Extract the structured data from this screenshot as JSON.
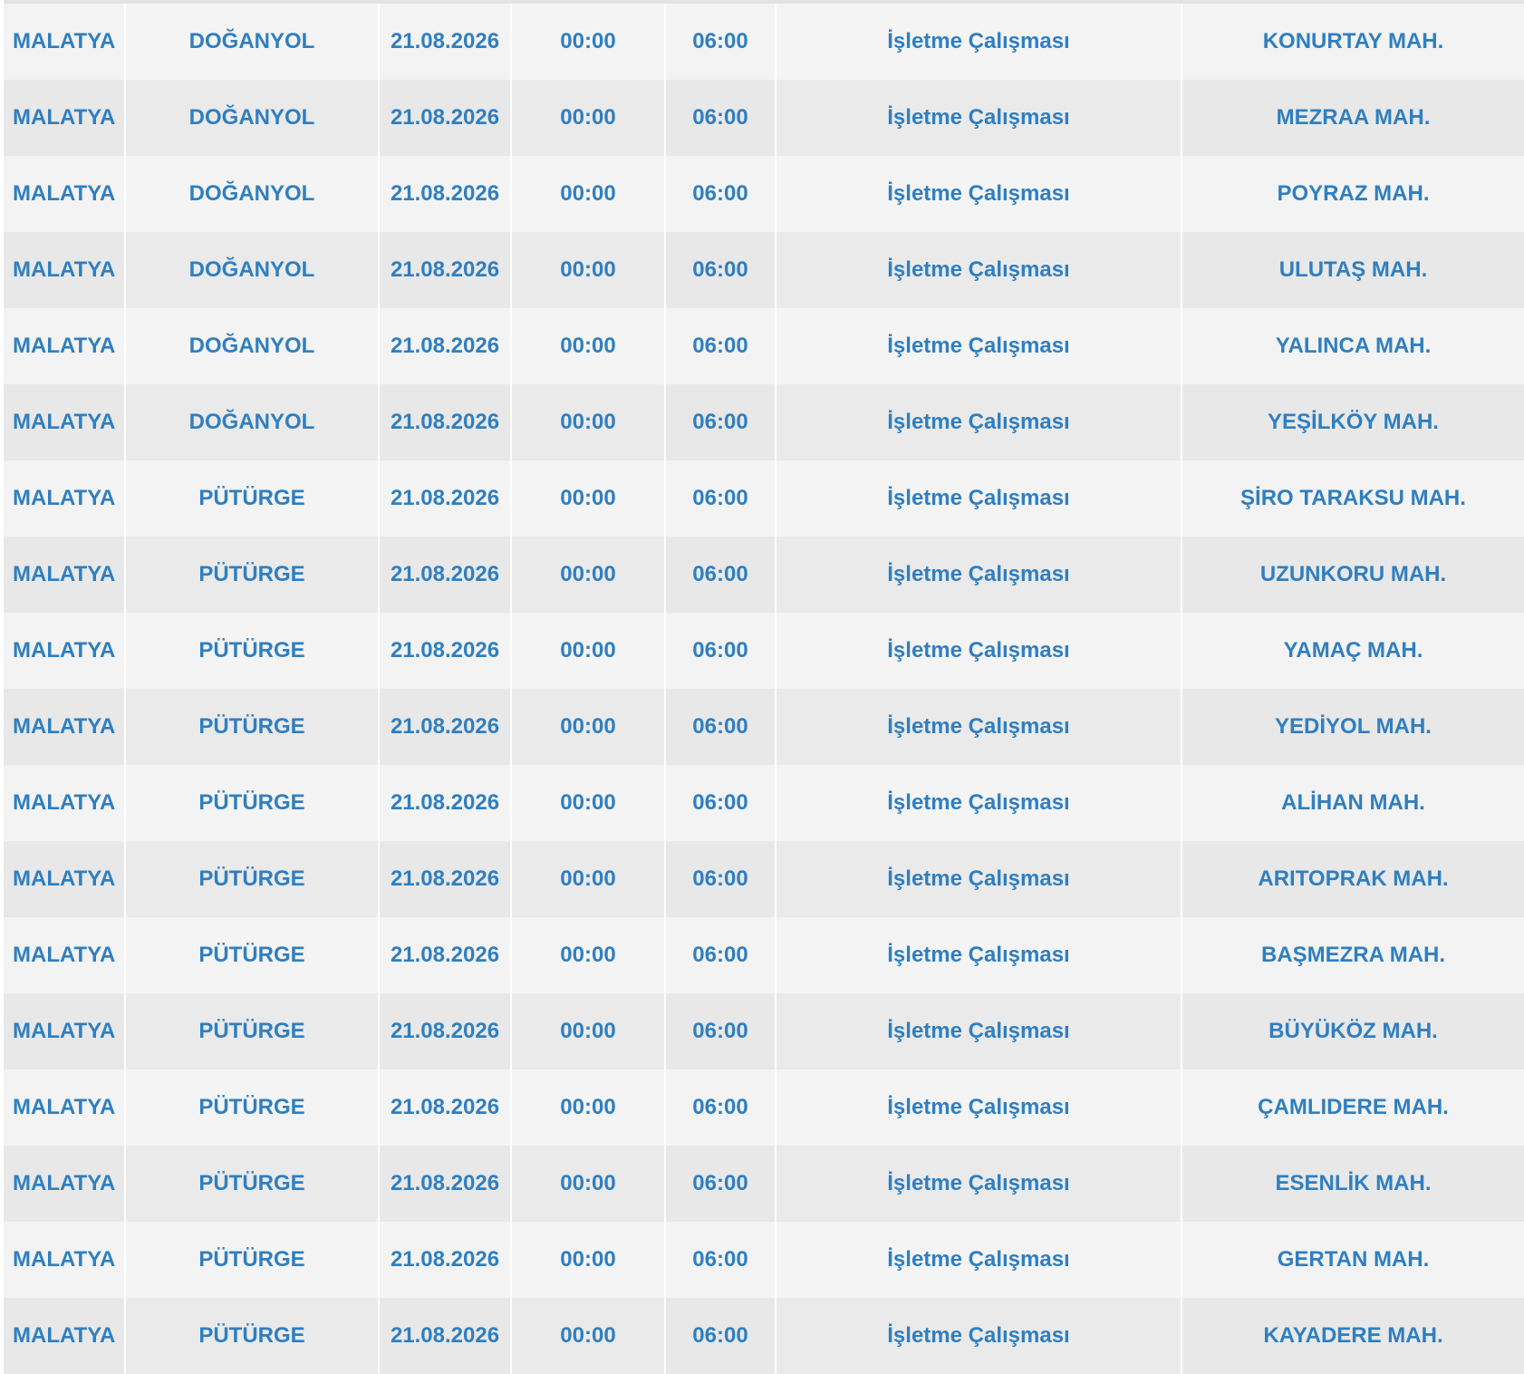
{
  "table": {
    "colors": {
      "text": "#2f7fc1",
      "row_light": "#f3f3f3",
      "row_dark": "#e8e8e8"
    },
    "rows": [
      {
        "il": "MALATYA",
        "ilce": "DOĞANYOL",
        "tarih": "21.08.2026",
        "baslangic": "00:00",
        "bitis": "06:00",
        "aciklama": "İşletme Çalışması",
        "mahalle": "KONURTAY MAH."
      },
      {
        "il": "MALATYA",
        "ilce": "DOĞANYOL",
        "tarih": "21.08.2026",
        "baslangic": "00:00",
        "bitis": "06:00",
        "aciklama": "İşletme Çalışması",
        "mahalle": "MEZRAA MAH."
      },
      {
        "il": "MALATYA",
        "ilce": "DOĞANYOL",
        "tarih": "21.08.2026",
        "baslangic": "00:00",
        "bitis": "06:00",
        "aciklama": "İşletme Çalışması",
        "mahalle": "POYRAZ MAH."
      },
      {
        "il": "MALATYA",
        "ilce": "DOĞANYOL",
        "tarih": "21.08.2026",
        "baslangic": "00:00",
        "bitis": "06:00",
        "aciklama": "İşletme Çalışması",
        "mahalle": "ULUTAŞ MAH."
      },
      {
        "il": "MALATYA",
        "ilce": "DOĞANYOL",
        "tarih": "21.08.2026",
        "baslangic": "00:00",
        "bitis": "06:00",
        "aciklama": "İşletme Çalışması",
        "mahalle": "YALINCA MAH."
      },
      {
        "il": "MALATYA",
        "ilce": "DOĞANYOL",
        "tarih": "21.08.2026",
        "baslangic": "00:00",
        "bitis": "06:00",
        "aciklama": "İşletme Çalışması",
        "mahalle": "YEŞİLKÖY MAH."
      },
      {
        "il": "MALATYA",
        "ilce": "PÜTÜRGE",
        "tarih": "21.08.2026",
        "baslangic": "00:00",
        "bitis": "06:00",
        "aciklama": "İşletme Çalışması",
        "mahalle": "ŞİRO TARAKSU MAH."
      },
      {
        "il": "MALATYA",
        "ilce": "PÜTÜRGE",
        "tarih": "21.08.2026",
        "baslangic": "00:00",
        "bitis": "06:00",
        "aciklama": "İşletme Çalışması",
        "mahalle": "UZUNKORU MAH."
      },
      {
        "il": "MALATYA",
        "ilce": "PÜTÜRGE",
        "tarih": "21.08.2026",
        "baslangic": "00:00",
        "bitis": "06:00",
        "aciklama": "İşletme Çalışması",
        "mahalle": "YAMAÇ MAH."
      },
      {
        "il": "MALATYA",
        "ilce": "PÜTÜRGE",
        "tarih": "21.08.2026",
        "baslangic": "00:00",
        "bitis": "06:00",
        "aciklama": "İşletme Çalışması",
        "mahalle": "YEDİYOL MAH."
      },
      {
        "il": "MALATYA",
        "ilce": "PÜTÜRGE",
        "tarih": "21.08.2026",
        "baslangic": "00:00",
        "bitis": "06:00",
        "aciklama": "İşletme Çalışması",
        "mahalle": "ALİHAN MAH."
      },
      {
        "il": "MALATYA",
        "ilce": "PÜTÜRGE",
        "tarih": "21.08.2026",
        "baslangic": "00:00",
        "bitis": "06:00",
        "aciklama": "İşletme Çalışması",
        "mahalle": "ARITOPRAK MAH."
      },
      {
        "il": "MALATYA",
        "ilce": "PÜTÜRGE",
        "tarih": "21.08.2026",
        "baslangic": "00:00",
        "bitis": "06:00",
        "aciklama": "İşletme Çalışması",
        "mahalle": "BAŞMEZRA MAH."
      },
      {
        "il": "MALATYA",
        "ilce": "PÜTÜRGE",
        "tarih": "21.08.2026",
        "baslangic": "00:00",
        "bitis": "06:00",
        "aciklama": "İşletme Çalışması",
        "mahalle": "BÜYÜKÖZ MAH."
      },
      {
        "il": "MALATYA",
        "ilce": "PÜTÜRGE",
        "tarih": "21.08.2026",
        "baslangic": "00:00",
        "bitis": "06:00",
        "aciklama": "İşletme Çalışması",
        "mahalle": "ÇAMLIDERE MAH."
      },
      {
        "il": "MALATYA",
        "ilce": "PÜTÜRGE",
        "tarih": "21.08.2026",
        "baslangic": "00:00",
        "bitis": "06:00",
        "aciklama": "İşletme Çalışması",
        "mahalle": "ESENLİK MAH."
      },
      {
        "il": "MALATYA",
        "ilce": "PÜTÜRGE",
        "tarih": "21.08.2026",
        "baslangic": "00:00",
        "bitis": "06:00",
        "aciklama": "İşletme Çalışması",
        "mahalle": "GERTAN MAH."
      },
      {
        "il": "MALATYA",
        "ilce": "PÜTÜRGE",
        "tarih": "21.08.2026",
        "baslangic": "00:00",
        "bitis": "06:00",
        "aciklama": "İşletme Çalışması",
        "mahalle": "KAYADERE MAH."
      }
    ]
  }
}
